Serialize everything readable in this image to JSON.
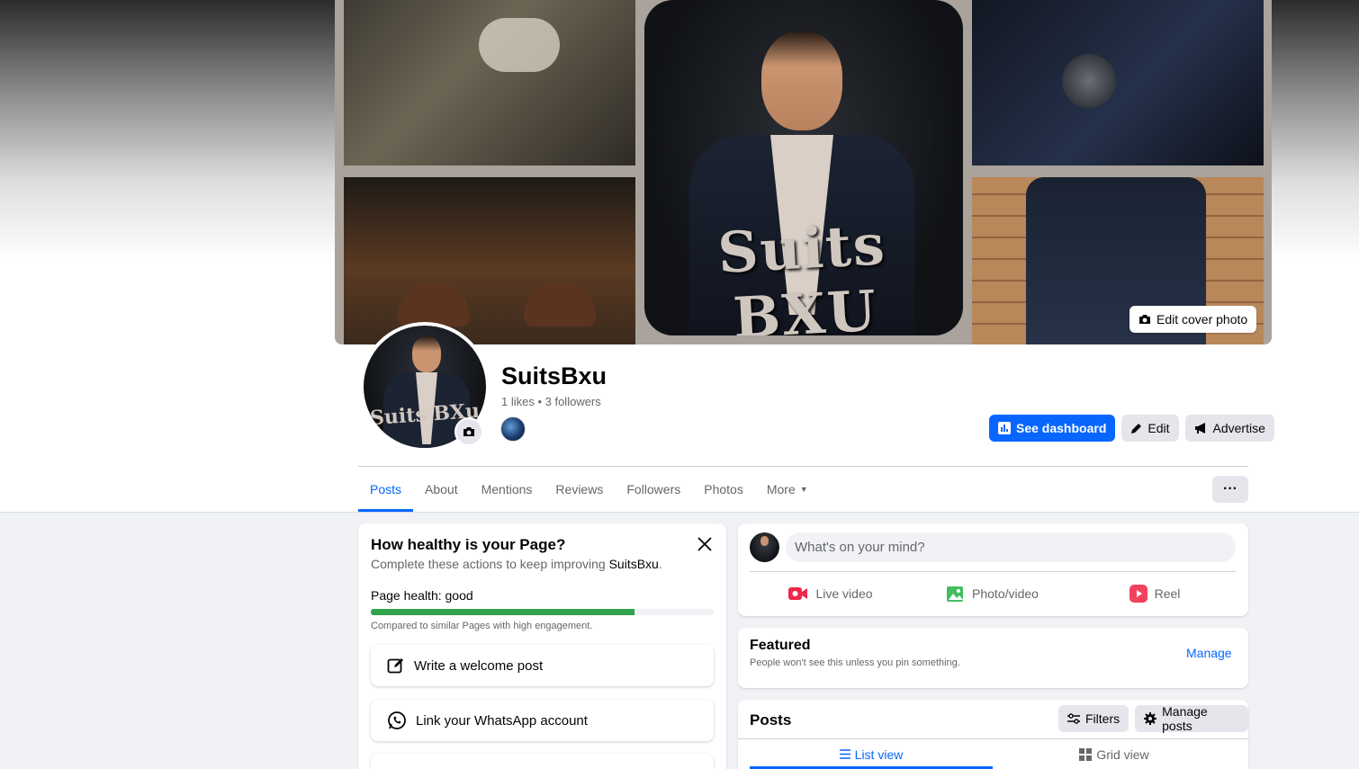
{
  "cover": {
    "brand_text": "Suits BXU",
    "edit_cover_label": "Edit cover photo"
  },
  "profile": {
    "avatar_text": "Suits BXu",
    "name": "SuitsBxu",
    "stats": "1 likes • 3 followers"
  },
  "actions": {
    "dashboard_label": "See dashboard",
    "edit_label": "Edit",
    "advertise_label": "Advertise"
  },
  "tabs": [
    {
      "label": "Posts",
      "active": true
    },
    {
      "label": "About"
    },
    {
      "label": "Mentions"
    },
    {
      "label": "Reviews"
    },
    {
      "label": "Followers"
    },
    {
      "label": "Photos"
    },
    {
      "label": "More"
    }
  ],
  "more_menu_label": "···",
  "health": {
    "title": "How healthy is your Page?",
    "subtitle_prefix": "Complete these actions to keep improving ",
    "subtitle_name": "SuitsBxu",
    "subtitle_suffix": ".",
    "health_label": "Page health: good",
    "health_progress": 0.77,
    "compare_text": "Compared to similar Pages with high engagement.",
    "tasks": [
      {
        "label": "Write a welcome post",
        "icon": "edit-icon"
      },
      {
        "label": "Link your WhatsApp account",
        "icon": "whatsapp-icon"
      },
      {
        "label": "",
        "icon": "arrow-icon"
      }
    ]
  },
  "composer": {
    "placeholder": "What's on your mind?",
    "actions": [
      {
        "label": "Live video",
        "icon": "live-video-icon",
        "color": "#f02849"
      },
      {
        "label": "Photo/video",
        "icon": "photo-icon",
        "color": "#45bd62"
      },
      {
        "label": "Reel",
        "icon": "reel-icon",
        "color": "#f3425f"
      }
    ]
  },
  "featured": {
    "title": "Featured",
    "subtitle": "People won't see this unless you pin something.",
    "manage_label": "Manage"
  },
  "posts": {
    "title": "Posts",
    "filters_label": "Filters",
    "manage_posts_label": "Manage posts",
    "list_view_label": "List view",
    "grid_view_label": "Grid view"
  },
  "colors": {
    "accent": "#0866ff",
    "progress": "#31a24c",
    "page_bg": "#f0f2f5"
  }
}
